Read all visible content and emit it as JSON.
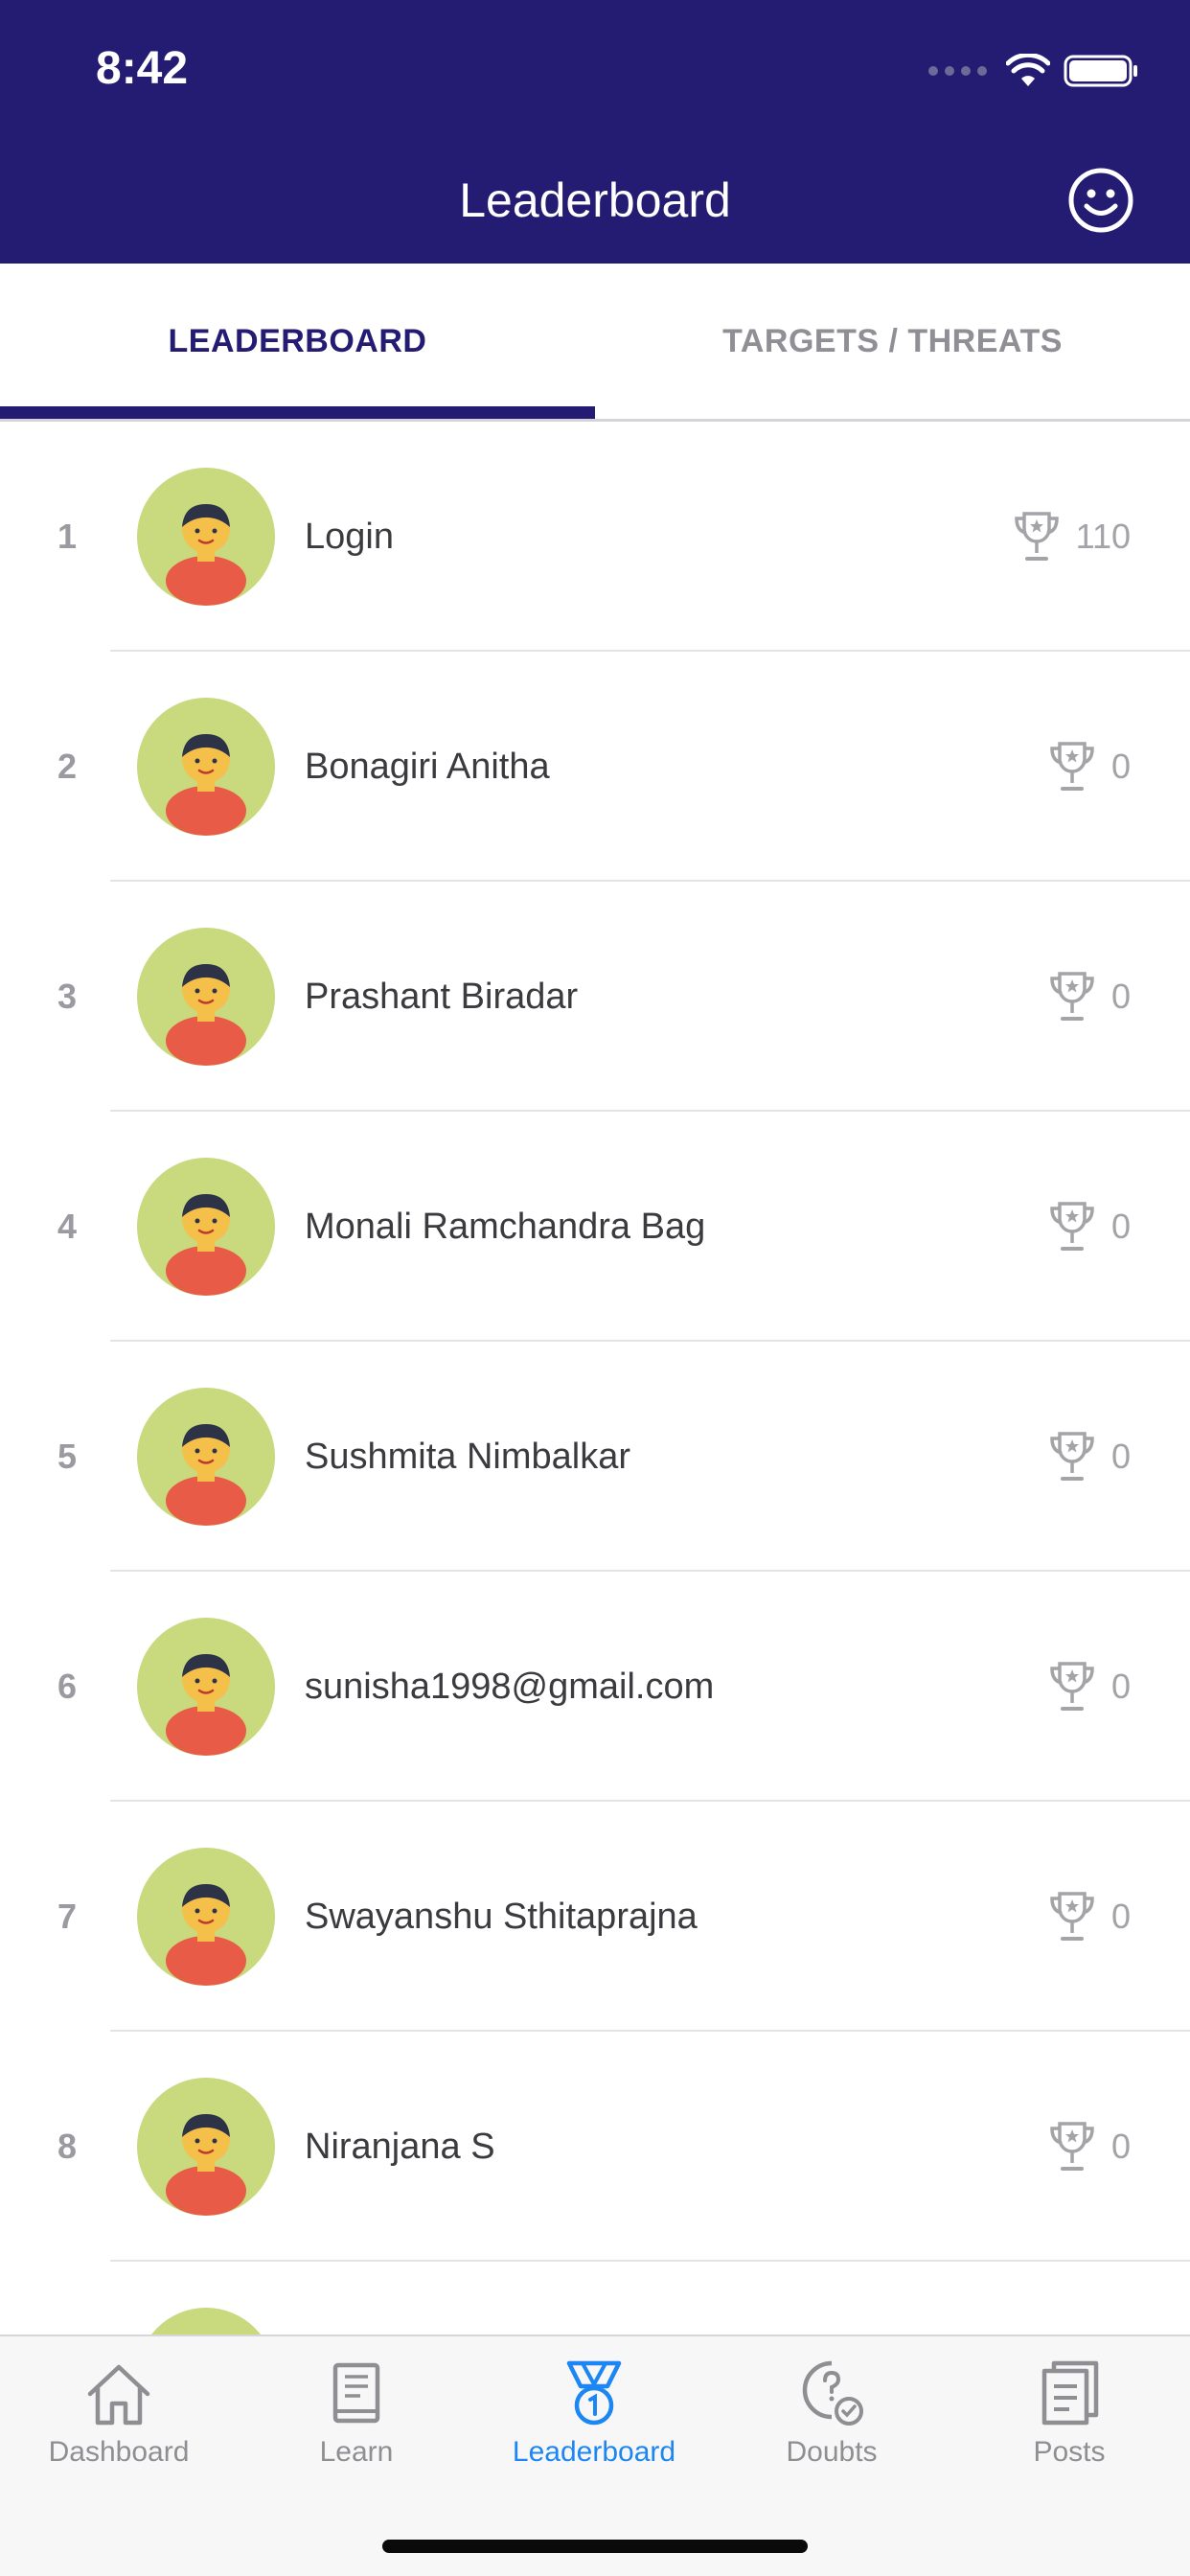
{
  "status_bar": {
    "time": "8:42"
  },
  "header": {
    "title": "Leaderboard"
  },
  "tabs": [
    {
      "label": "LEADERBOARD",
      "active": true
    },
    {
      "label": "TARGETS / THREATS",
      "active": false
    }
  ],
  "leaderboard": [
    {
      "rank": "1",
      "name": "Login",
      "score": "110"
    },
    {
      "rank": "2",
      "name": "Bonagiri Anitha",
      "score": "0"
    },
    {
      "rank": "3",
      "name": "Prashant Biradar",
      "score": "0"
    },
    {
      "rank": "4",
      "name": "Monali Ramchandra Bag",
      "score": "0"
    },
    {
      "rank": "5",
      "name": "Sushmita Nimbalkar",
      "score": "0"
    },
    {
      "rank": "6",
      "name": "sunisha1998@gmail.com",
      "score": "0"
    },
    {
      "rank": "7",
      "name": "Swayanshu Sthitaprajna",
      "score": "0"
    },
    {
      "rank": "8",
      "name": "Niranjana S",
      "score": "0"
    }
  ],
  "bottom_nav": [
    {
      "label": "Dashboard",
      "icon": "home-icon",
      "active": false
    },
    {
      "label": "Learn",
      "icon": "book-icon",
      "active": false
    },
    {
      "label": "Leaderboard",
      "icon": "medal-icon",
      "active": true
    },
    {
      "label": "Doubts",
      "icon": "question-bubble-icon",
      "active": false
    },
    {
      "label": "Posts",
      "icon": "document-icon",
      "active": false
    }
  ],
  "colors": {
    "header_bg": "#241c72",
    "accent": "#241c72",
    "active_nav": "#1c86f2",
    "avatar_bg": "#c8d97e"
  }
}
